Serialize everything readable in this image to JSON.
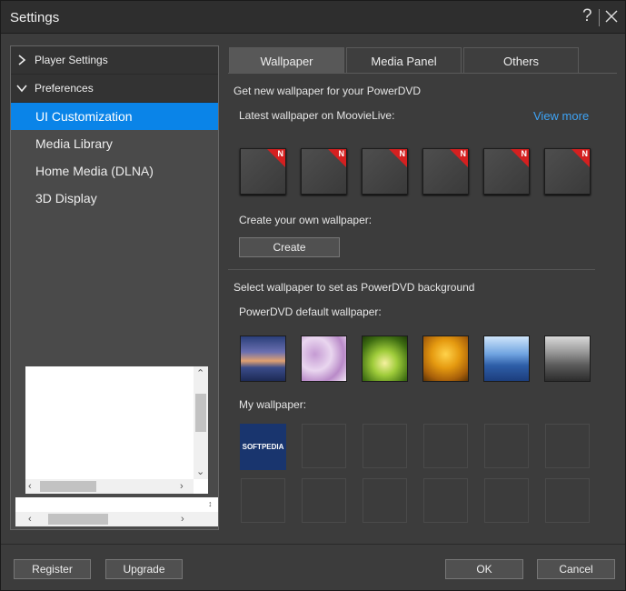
{
  "window": {
    "title": "Settings",
    "help_glyph": "?"
  },
  "sidebar": {
    "groups": [
      {
        "label": "Player Settings",
        "expanded": false
      },
      {
        "label": "Preferences",
        "expanded": true
      }
    ],
    "items": [
      {
        "label": "UI Customization",
        "selected": true
      },
      {
        "label": "Media Library",
        "selected": false
      },
      {
        "label": "Home Media (DLNA)",
        "selected": false
      },
      {
        "label": "3D Display",
        "selected": false
      }
    ]
  },
  "tabs": [
    {
      "label": "Wallpaper",
      "active": true
    },
    {
      "label": "Media Panel",
      "active": false
    },
    {
      "label": "Others",
      "active": false
    }
  ],
  "wallpaper": {
    "get_new_heading": "Get new wallpaper for your PowerDVD",
    "latest_label": "Latest wallpaper on MoovieLive:",
    "view_more": "View more",
    "new_badge": "N",
    "latest_count": 6,
    "create_label": "Create your own wallpaper:",
    "create_button": "Create",
    "select_heading": "Select wallpaper to set as PowerDVD background",
    "default_label": "PowerDVD default wallpaper:",
    "default_wallpapers": [
      "sunset-lake",
      "lavender-flowers",
      "green-forest",
      "autumn-trees",
      "blue-mountains",
      "city-skyline"
    ],
    "my_label": "My wallpaper:",
    "my_first_tile": "SOFTPEDIA"
  },
  "footer": {
    "register": "Register",
    "upgrade": "Upgrade",
    "ok": "OK",
    "cancel": "Cancel"
  },
  "colors": {
    "accent": "#0a84e8",
    "link": "#3ea3f5",
    "badge": "#d42020"
  }
}
